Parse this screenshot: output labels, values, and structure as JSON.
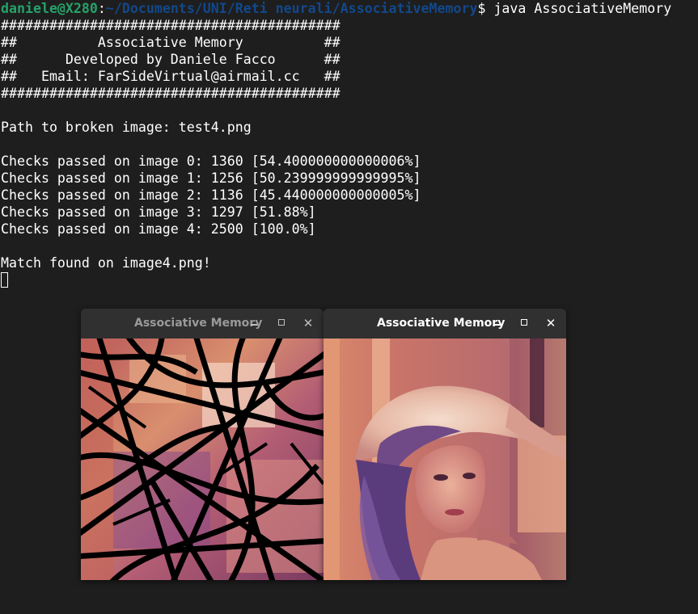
{
  "terminal": {
    "prompt_user": "daniele@X280",
    "prompt_sep": ":",
    "prompt_path": "~/Documents/UNI/Reti neurali/AssociativeMemory",
    "prompt_symbol": "$ ",
    "command": "java AssociativeMemory",
    "lines": [
      "##########################################",
      "##          Associative Memory          ##",
      "##      Developed by Daniele Facco      ##",
      "##   Email: FarSideVirtual@airmail.cc   ##",
      "##########################################",
      "",
      "Path to broken image: test4.png",
      "",
      "Checks passed on image 0: 1360 [54.400000000000006%]",
      "Checks passed on image 1: 1256 [50.239999999999995%]",
      "Checks passed on image 2: 1136 [45.440000000000005%]",
      "Checks passed on image 3: 1297 [51.88%]",
      "Checks passed on image 4: 2500 [100.0%]",
      "",
      "Match found on image4.png!"
    ]
  },
  "windows": [
    {
      "title": "Associative Memory",
      "focused": false,
      "title_color": "#9a9a9a",
      "image_kind": "broken"
    },
    {
      "title": "Associative Memory",
      "focused": true,
      "title_color": "#ffffff",
      "image_kind": "restored"
    }
  ],
  "icons": {
    "minimize": "minimize-icon",
    "maximize": "maximize-icon",
    "close": "close-icon"
  }
}
